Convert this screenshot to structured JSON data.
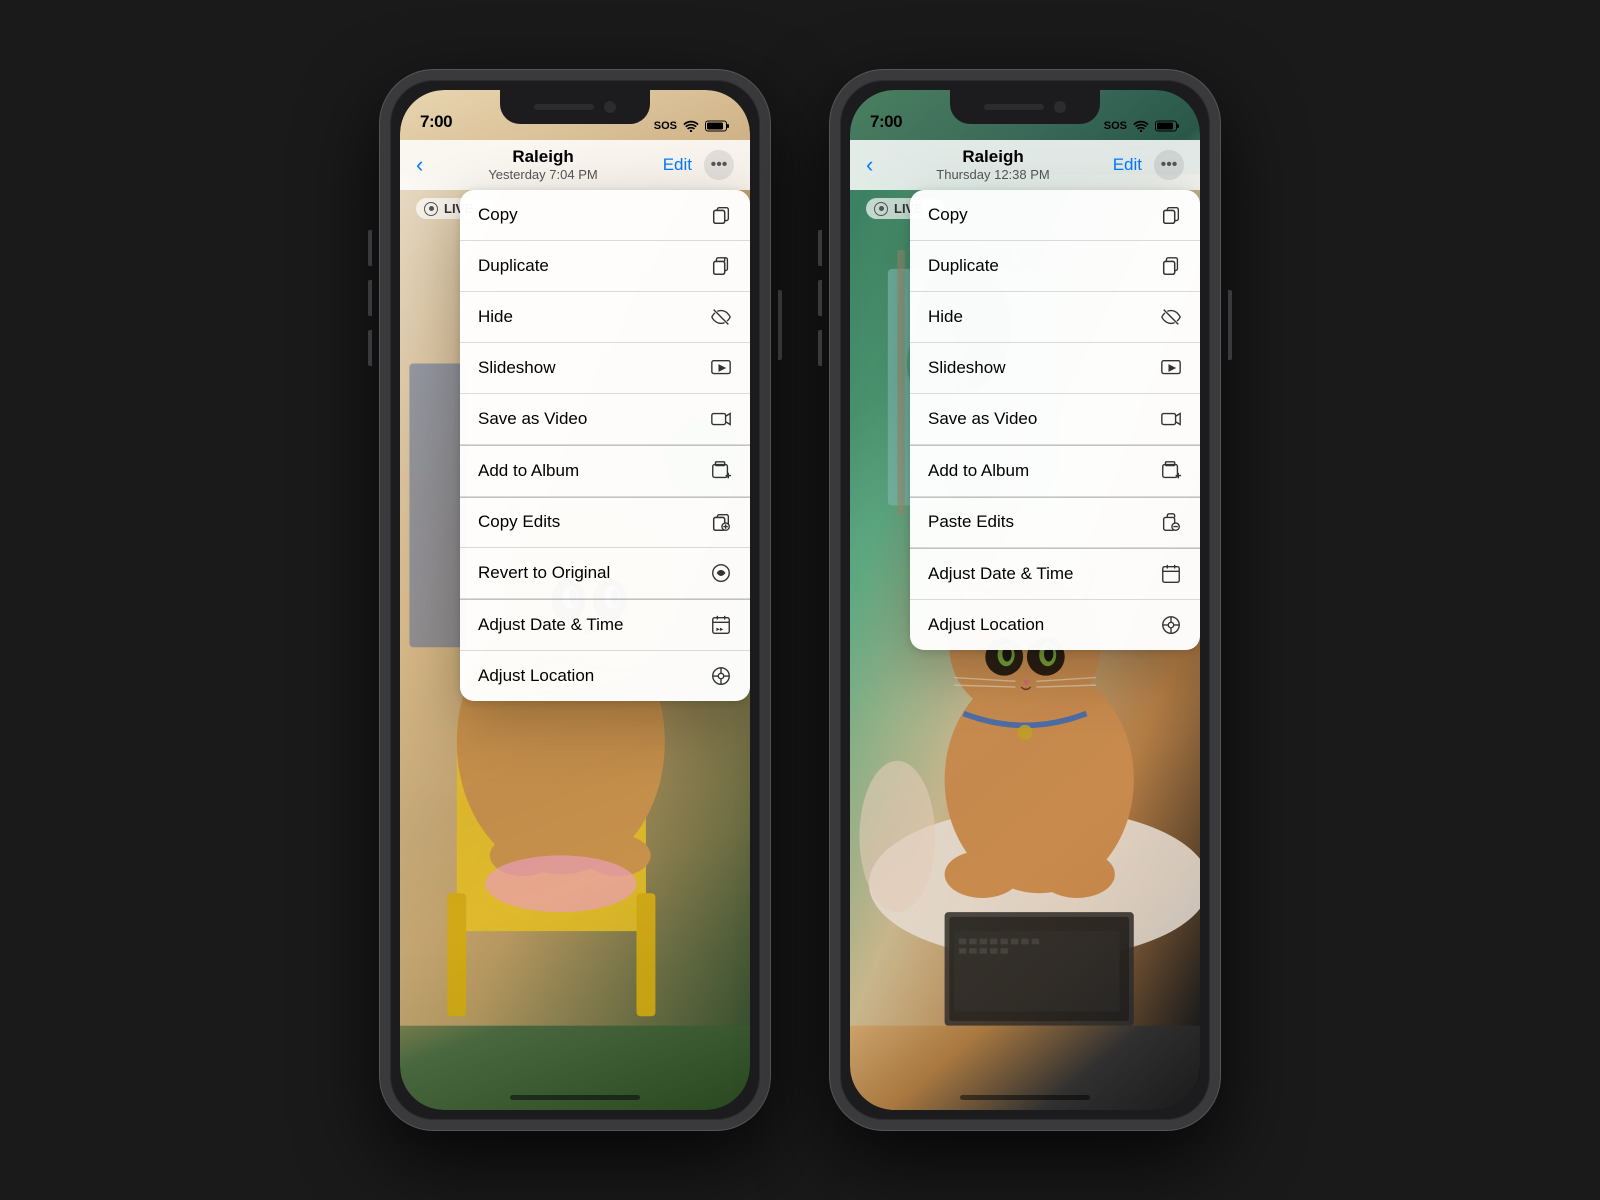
{
  "phones": [
    {
      "id": "left",
      "statusBar": {
        "time": "7:00",
        "sos": "SOS",
        "wifi": true,
        "battery": true
      },
      "nav": {
        "back": "←",
        "title": "Raleigh",
        "subtitle": "Yesterday  7:04 PM",
        "edit": "Edit"
      },
      "live": "LIVE",
      "menu": {
        "groups": [
          [
            {
              "label": "Copy",
              "icon": "copy"
            },
            {
              "label": "Duplicate",
              "icon": "duplicate"
            },
            {
              "label": "Hide",
              "icon": "hide"
            },
            {
              "label": "Slideshow",
              "icon": "slideshow"
            },
            {
              "label": "Save as Video",
              "icon": "video"
            }
          ],
          [
            {
              "label": "Add to Album",
              "icon": "add-album"
            }
          ],
          [
            {
              "label": "Copy Edits",
              "icon": "copy-edits"
            },
            {
              "label": "Revert to Original",
              "icon": "revert"
            }
          ],
          [
            {
              "label": "Adjust Date & Time",
              "icon": "calendar"
            },
            {
              "label": "Adjust Location",
              "icon": "location"
            }
          ]
        ]
      }
    },
    {
      "id": "right",
      "statusBar": {
        "time": "7:00",
        "sos": "SOS",
        "wifi": true,
        "battery": true
      },
      "nav": {
        "back": "←",
        "title": "Raleigh",
        "subtitle": "Thursday  12:38 PM",
        "edit": "Edit"
      },
      "live": "LIVE",
      "menu": {
        "groups": [
          [
            {
              "label": "Copy",
              "icon": "copy"
            },
            {
              "label": "Duplicate",
              "icon": "duplicate"
            },
            {
              "label": "Hide",
              "icon": "hide"
            },
            {
              "label": "Slideshow",
              "icon": "slideshow"
            },
            {
              "label": "Save as Video",
              "icon": "video"
            }
          ],
          [
            {
              "label": "Add to Album",
              "icon": "add-album"
            }
          ],
          [
            {
              "label": "Paste Edits",
              "icon": "paste-edits"
            }
          ],
          [
            {
              "label": "Adjust Date & Time",
              "icon": "calendar"
            },
            {
              "label": "Adjust Location",
              "icon": "location"
            }
          ]
        ]
      }
    }
  ]
}
